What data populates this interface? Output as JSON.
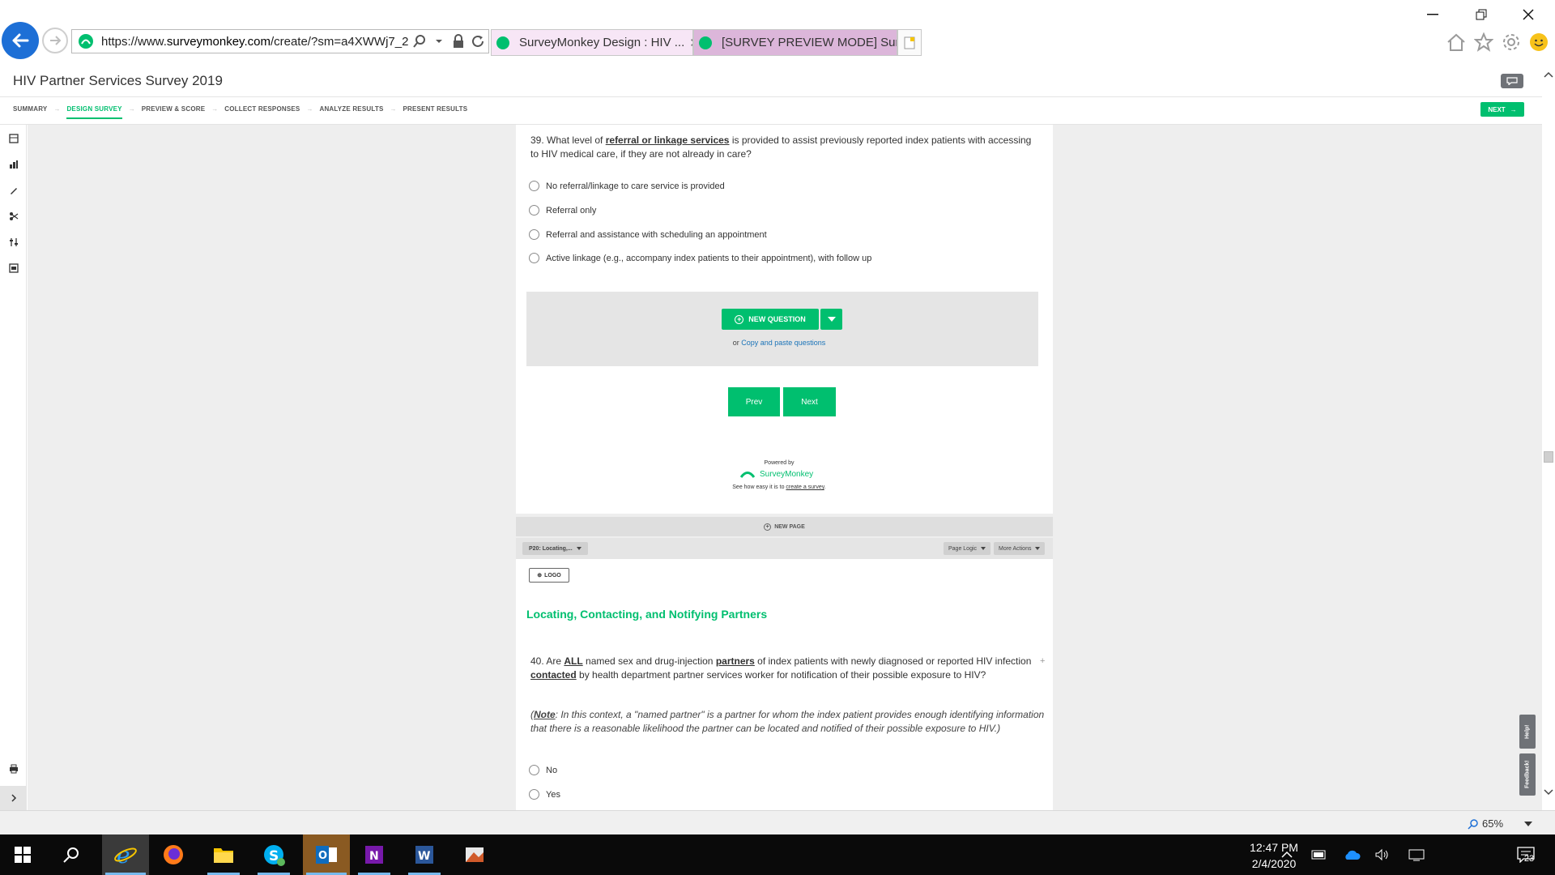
{
  "browser": {
    "url_prefix": "https://www.",
    "url_domain": "surveymonkey.com",
    "url_rest": "/create/?sm=a4XWWj7_2",
    "tabs": [
      {
        "label": "SurveyMonkey Design : HIV ..."
      },
      {
        "label": "[SURVEY PREVIEW MODE] Surv..."
      }
    ]
  },
  "app": {
    "survey_title": "HIV Partner Services Survey 2019",
    "steps": [
      "SUMMARY",
      "DESIGN SURVEY",
      "PREVIEW & SCORE",
      "COLLECT RESPONSES",
      "ANALYZE RESULTS",
      "PRESENT RESULTS"
    ],
    "active_step": "DESIGN SURVEY",
    "next_label": "NEXT",
    "accent_color": "#00bf6f"
  },
  "q39": {
    "prefix": "39. What level of ",
    "term": "referral or linkage services",
    "rest": "  is provided to assist previously reported index patients with accessing to HIV medical care, if they are not already in care?",
    "options": [
      "No referral/linkage to care service is provided",
      "Referral only",
      "Referral and assistance with scheduling an appointment",
      "Active linkage (e.g., accompany index patients to their appointment), with follow up"
    ]
  },
  "builder": {
    "new_question_label": "NEW QUESTION",
    "or_text": "or ",
    "copy_paste_link": "Copy and paste questions",
    "prev_label": "Prev",
    "next_label": "Next",
    "powered_by": "Powered by",
    "brand": "SurveyMonkey",
    "see_how_prefix": "See how easy it is to ",
    "see_how_link": "create a survey",
    "see_how_suffix": ".",
    "new_page_label": "NEW PAGE",
    "page_select": "P20: Locating,...",
    "page_logic": "Page Logic",
    "more_actions": "More Actions",
    "logo_label": "LOGO"
  },
  "page20": {
    "title": "Locating, Contacting, and Notifying Partners"
  },
  "q40": {
    "p1": "40. Are  ",
    "w_all": "ALL",
    "p2": "  named sex and drug-injection  ",
    "w_partners": "partners",
    "p3": "  of index patients with newly diagnosed or reported HIV infection  ",
    "w_contacted": "contacted",
    "p4": "  by health department partner services worker for notification of their possible exposure to HIV?",
    "note_open": "(",
    "note_label": "Note",
    "note_text": ": In this context, a \"named partner\" is a partner for whom the index patient provides enough identifying information that there is a reasonable likelihood the partner can be located and notified of their possible exposure to HIV.)",
    "options": [
      "No",
      "Yes"
    ]
  },
  "side_tabs": {
    "help": "Help!",
    "feedback": "Feedback!"
  },
  "status": {
    "zoom": "65%"
  },
  "taskbar": {
    "time": "12:47 PM",
    "date": "2/4/2020",
    "notifications": "23"
  }
}
